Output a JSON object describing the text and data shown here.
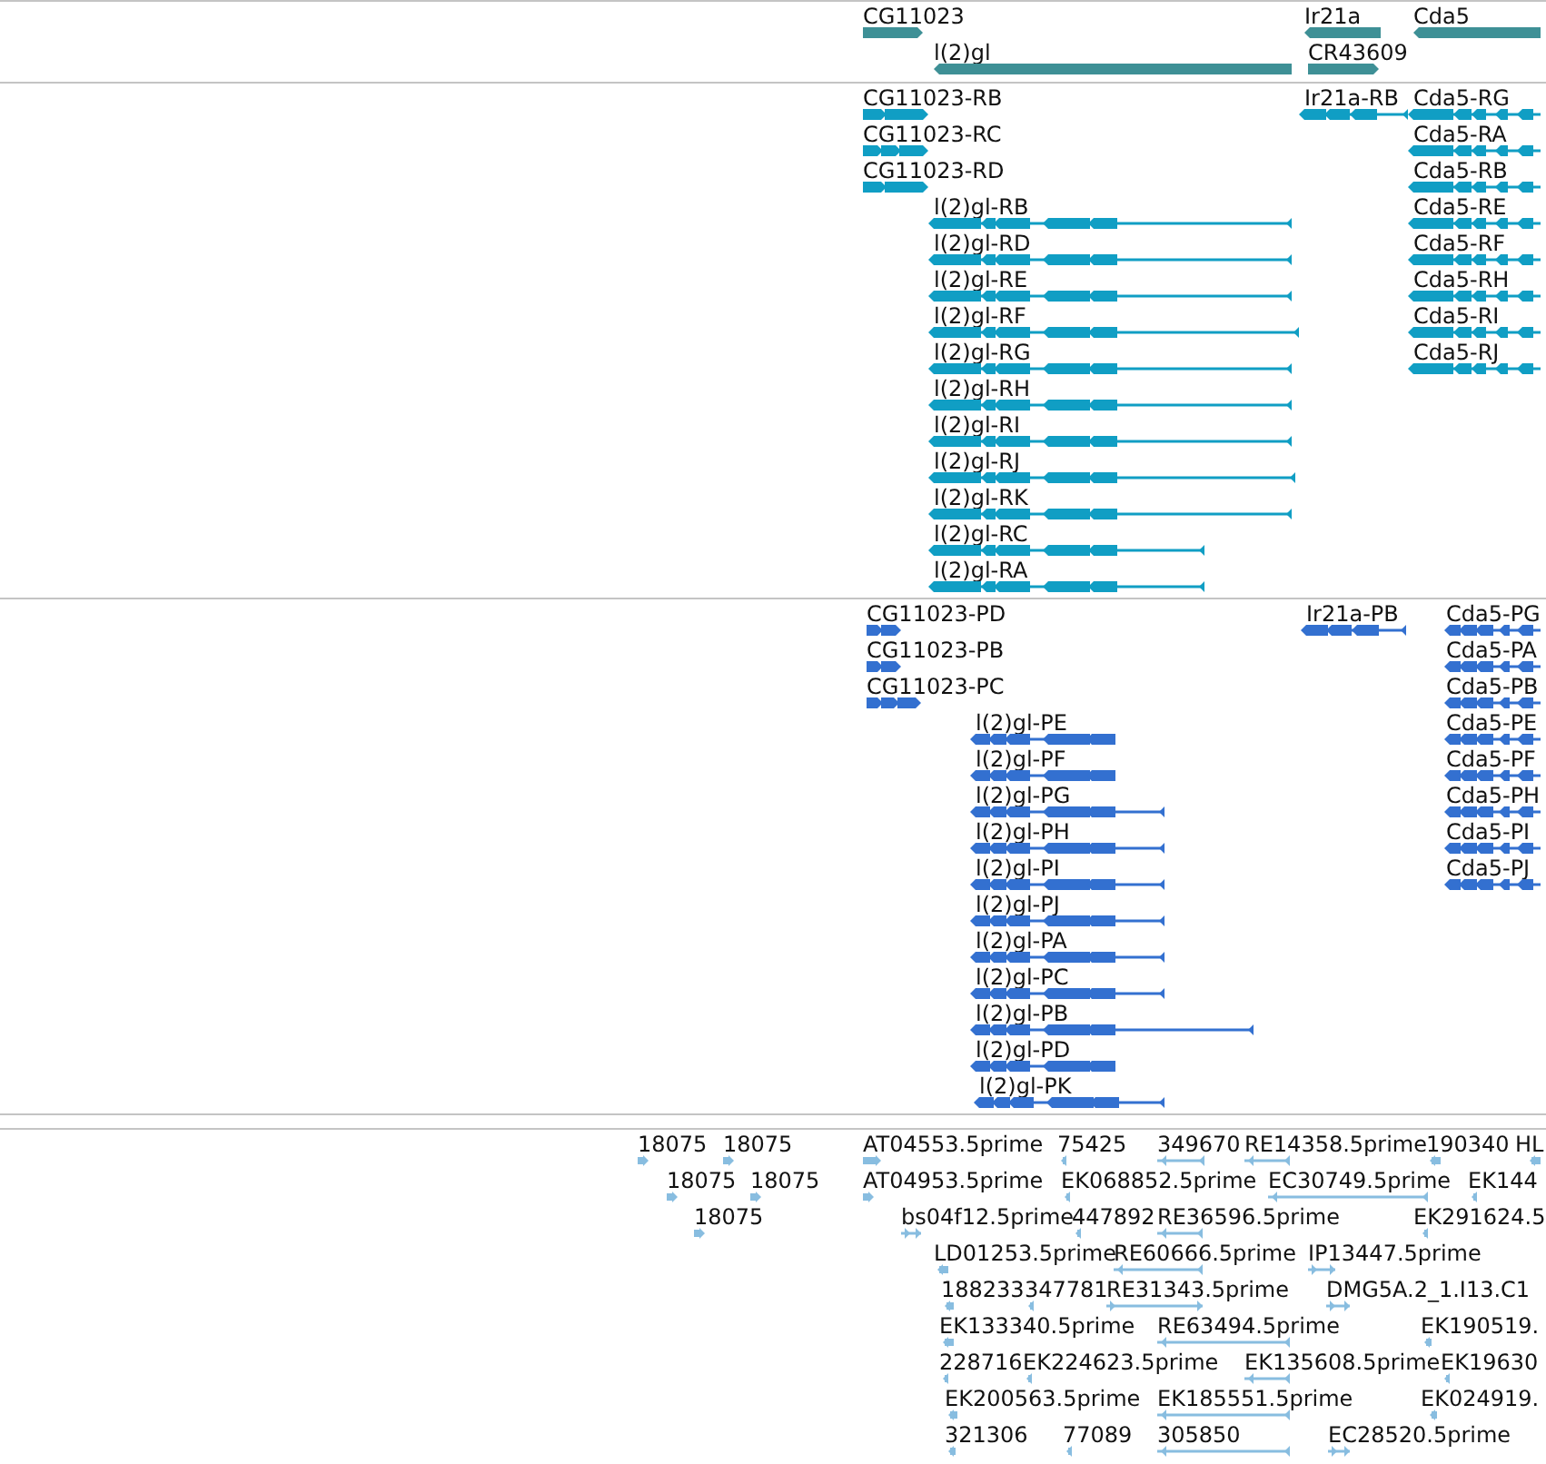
{
  "tracks": [
    {
      "kind": "gene",
      "features": [
        {
          "label": "CG11023",
          "reverse": false
        },
        {
          "label": "l(2)gl",
          "reverse": true
        },
        {
          "label": "Ir21a",
          "reverse": true
        },
        {
          "label": "CR43609",
          "reverse": false
        },
        {
          "label": "Cda5",
          "reverse": true
        }
      ]
    },
    {
      "kind": "transcript",
      "features": [
        {
          "label": "CG11023-RB",
          "reverse": false
        },
        {
          "label": "CG11023-RC",
          "reverse": false
        },
        {
          "label": "CG11023-RD",
          "reverse": false
        },
        {
          "label": "l(2)gl-RB",
          "reverse": true
        },
        {
          "label": "l(2)gl-RD",
          "reverse": true
        },
        {
          "label": "l(2)gl-RE",
          "reverse": true
        },
        {
          "label": "l(2)gl-RF",
          "reverse": true
        },
        {
          "label": "l(2)gl-RG",
          "reverse": true
        },
        {
          "label": "l(2)gl-RH",
          "reverse": true
        },
        {
          "label": "l(2)gl-RI",
          "reverse": true
        },
        {
          "label": "l(2)gl-RJ",
          "reverse": true
        },
        {
          "label": "l(2)gl-RK",
          "reverse": true
        },
        {
          "label": "l(2)gl-RC",
          "reverse": true
        },
        {
          "label": "l(2)gl-RA",
          "reverse": true
        },
        {
          "label": "Ir21a-RB",
          "reverse": true
        },
        {
          "label": "Cda5-RG",
          "reverse": true
        },
        {
          "label": "Cda5-RA",
          "reverse": true
        },
        {
          "label": "Cda5-RB",
          "reverse": true
        },
        {
          "label": "Cda5-RE",
          "reverse": true
        },
        {
          "label": "Cda5-RF",
          "reverse": true
        },
        {
          "label": "Cda5-RH",
          "reverse": true
        },
        {
          "label": "Cda5-RI",
          "reverse": true
        },
        {
          "label": "Cda5-RJ",
          "reverse": true
        }
      ]
    },
    {
      "kind": "protein",
      "features": [
        {
          "label": "CG11023-PD",
          "reverse": false
        },
        {
          "label": "CG11023-PB",
          "reverse": false
        },
        {
          "label": "CG11023-PC",
          "reverse": false
        },
        {
          "label": "l(2)gl-PE",
          "reverse": true
        },
        {
          "label": "l(2)gl-PF",
          "reverse": true
        },
        {
          "label": "l(2)gl-PG",
          "reverse": true
        },
        {
          "label": "l(2)gl-PH",
          "reverse": true
        },
        {
          "label": "l(2)gl-PI",
          "reverse": true
        },
        {
          "label": "l(2)gl-PJ",
          "reverse": true
        },
        {
          "label": "l(2)gl-PA",
          "reverse": true
        },
        {
          "label": "l(2)gl-PC",
          "reverse": true
        },
        {
          "label": "l(2)gl-PB",
          "reverse": true
        },
        {
          "label": "l(2)gl-PD",
          "reverse": true
        },
        {
          "label": "l(2)gl-PK",
          "reverse": true
        },
        {
          "label": "Ir21a-PB",
          "reverse": true
        },
        {
          "label": "Cda5-PG",
          "reverse": true
        },
        {
          "label": "Cda5-PA",
          "reverse": true
        },
        {
          "label": "Cda5-PB",
          "reverse": true
        },
        {
          "label": "Cda5-PE",
          "reverse": true
        },
        {
          "label": "Cda5-PF",
          "reverse": true
        },
        {
          "label": "Cda5-PH",
          "reverse": true
        },
        {
          "label": "Cda5-PI",
          "reverse": true
        },
        {
          "label": "Cda5-PJ",
          "reverse": true
        }
      ]
    },
    {
      "kind": "est",
      "features": [
        {
          "label": "18075",
          "reverse": false
        },
        {
          "label": "18075",
          "reverse": false
        },
        {
          "label": "AT04553.5prime",
          "reverse": false
        },
        {
          "label": "75425",
          "reverse": true
        },
        {
          "label": "349670",
          "reverse": true
        },
        {
          "label": "RE14358.5prime",
          "reverse": true
        },
        {
          "label": "190340",
          "reverse": true
        },
        {
          "label": "HL",
          "reverse": true
        },
        {
          "label": "18075",
          "reverse": false
        },
        {
          "label": "18075",
          "reverse": false
        },
        {
          "label": "AT04953.5prime",
          "reverse": false
        },
        {
          "label": "EK068852.5prime",
          "reverse": true
        },
        {
          "label": "EC30749.5prime",
          "reverse": true
        },
        {
          "label": "EK144",
          "reverse": true
        },
        {
          "label": "18075",
          "reverse": false
        },
        {
          "label": "bs04f12.5prime",
          "reverse": false
        },
        {
          "label": "447892",
          "reverse": true
        },
        {
          "label": "RE36596.5prime",
          "reverse": true
        },
        {
          "label": "EK291624.5",
          "reverse": true
        },
        {
          "label": "LD01253.5prime",
          "reverse": true
        },
        {
          "label": "RE60666.5prime",
          "reverse": true
        },
        {
          "label": "IP13447.5prime",
          "reverse": false
        },
        {
          "label": "188233",
          "reverse": true
        },
        {
          "label": "347781",
          "reverse": true
        },
        {
          "label": "RE31343.5prime",
          "reverse": false
        },
        {
          "label": "DMG5A.2_1.I13.C1",
          "reverse": false
        },
        {
          "label": "EK133340.5prime",
          "reverse": true
        },
        {
          "label": "RE63494.5prime",
          "reverse": true
        },
        {
          "label": "EK190519.",
          "reverse": true
        },
        {
          "label": "228716",
          "reverse": true
        },
        {
          "label": "EK224623.5prime",
          "reverse": true
        },
        {
          "label": "EK135608.5prime",
          "reverse": true
        },
        {
          "label": "EK19630",
          "reverse": true
        },
        {
          "label": "EK200563.5prime",
          "reverse": true
        },
        {
          "label": "EK185551.5prime",
          "reverse": true
        },
        {
          "label": "EK024919.",
          "reverse": true
        },
        {
          "label": "321306",
          "reverse": true
        },
        {
          "label": "77089",
          "reverse": true
        },
        {
          "label": "305850",
          "reverse": true
        },
        {
          "label": "EC28520.5prime",
          "reverse": false
        }
      ]
    }
  ]
}
